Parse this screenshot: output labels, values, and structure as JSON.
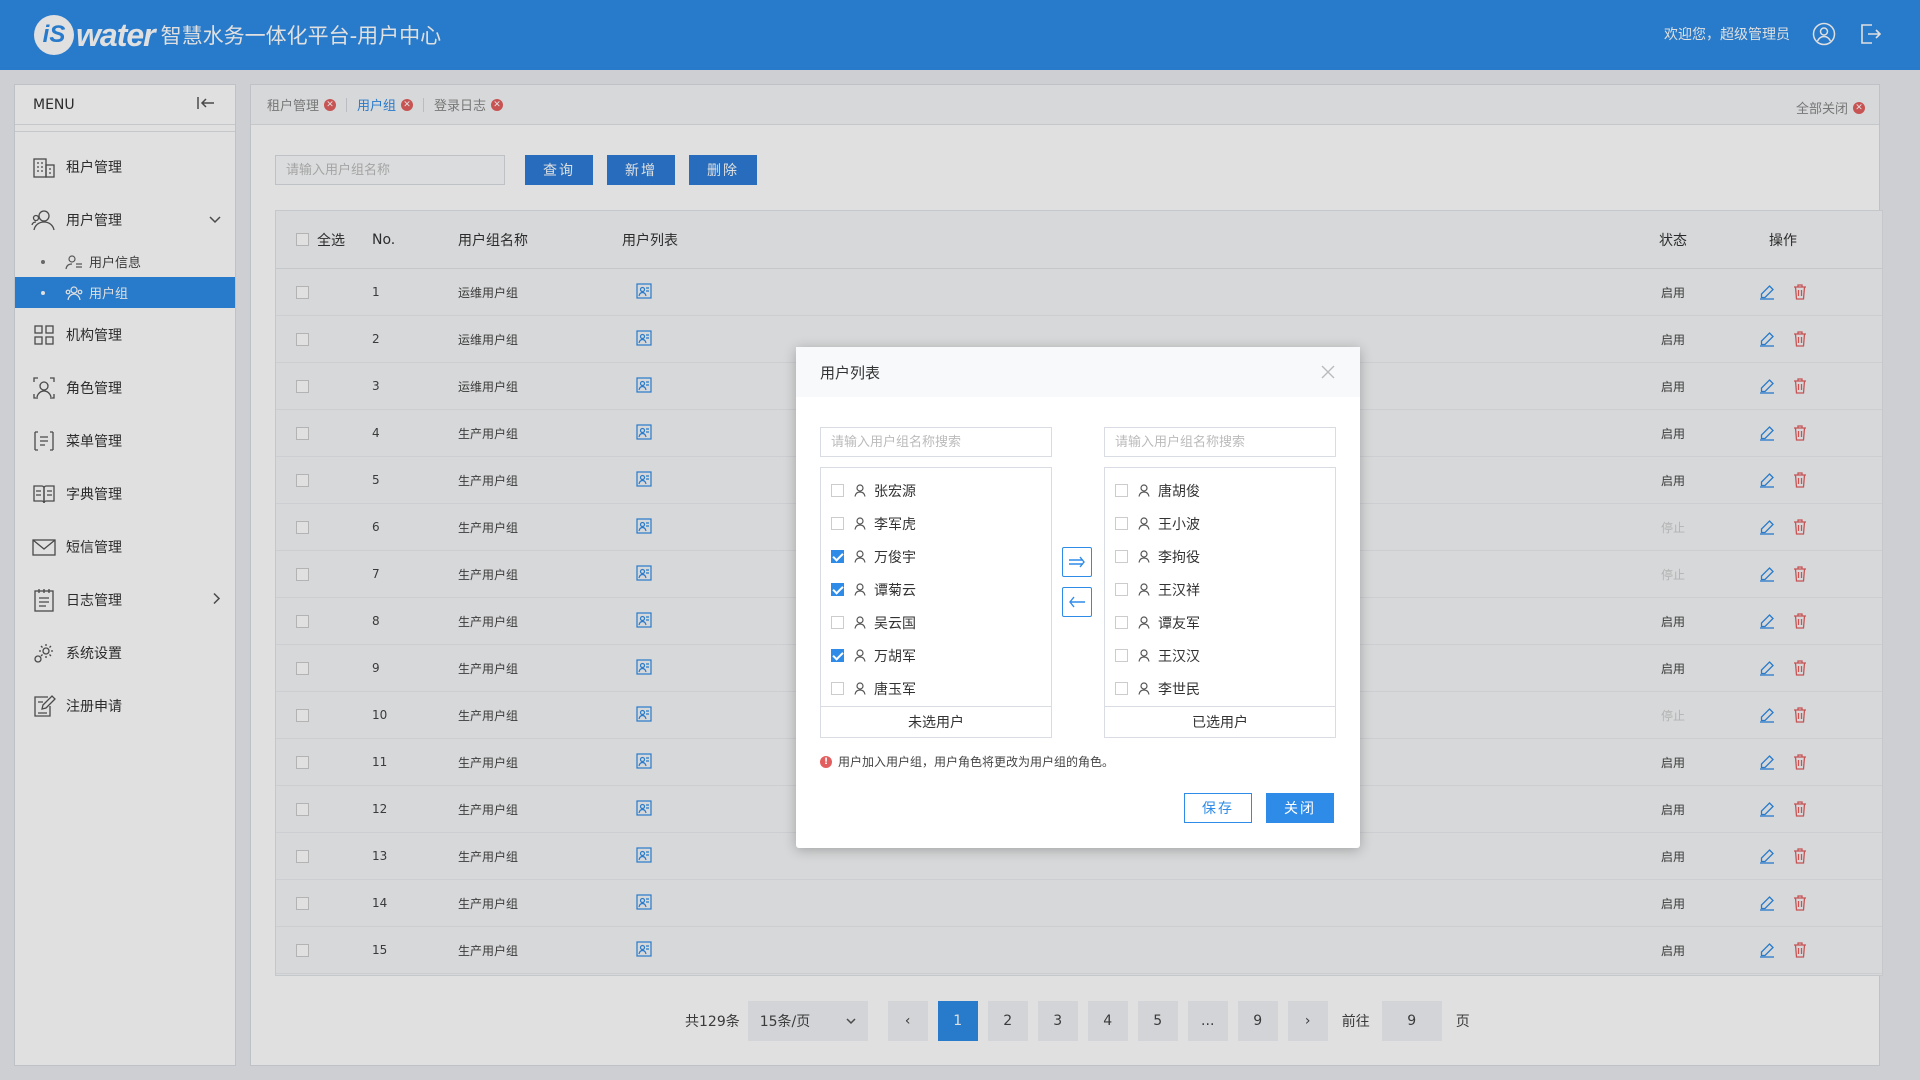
{
  "header": {
    "logo_is": "iS",
    "logo_water": "water",
    "title": "智慧水务一体化平台-用户中心",
    "welcome": "欢迎您，超级管理员"
  },
  "sidebar": {
    "menu_label": "MENU",
    "items": [
      {
        "label": "租户管理"
      },
      {
        "label": "用户管理"
      },
      {
        "label": "机构管理"
      },
      {
        "label": "角色管理"
      },
      {
        "label": "菜单管理"
      },
      {
        "label": "字典管理"
      },
      {
        "label": "短信管理"
      },
      {
        "label": "日志管理"
      },
      {
        "label": "系统设置"
      },
      {
        "label": "注册申请"
      }
    ],
    "sub_items": [
      {
        "label": "用户信息"
      },
      {
        "label": "用户组"
      }
    ]
  },
  "tabs": [
    {
      "label": "租户管理"
    },
    {
      "label": "用户组"
    },
    {
      "label": "登录日志"
    }
  ],
  "close_all": "全部关闭",
  "toolbar": {
    "search_placeholder": "请输入用户组名称",
    "query": "查询",
    "add": "新增",
    "delete": "删除"
  },
  "table": {
    "headers": {
      "select_all": "全选",
      "no": "No.",
      "name": "用户组名称",
      "list": "用户列表",
      "status": "状态",
      "ops": "操作"
    },
    "rows": [
      {
        "no": "1",
        "name": "运维用户组",
        "status": "启用",
        "active": true
      },
      {
        "no": "2",
        "name": "运维用户组",
        "status": "启用",
        "active": true
      },
      {
        "no": "3",
        "name": "运维用户组",
        "status": "启用",
        "active": true
      },
      {
        "no": "4",
        "name": "生产用户组",
        "status": "启用",
        "active": true
      },
      {
        "no": "5",
        "name": "生产用户组",
        "status": "启用",
        "active": true
      },
      {
        "no": "6",
        "name": "生产用户组",
        "status": "停止",
        "active": false
      },
      {
        "no": "7",
        "name": "生产用户组",
        "status": "停止",
        "active": false
      },
      {
        "no": "8",
        "name": "生产用户组",
        "status": "启用",
        "active": true
      },
      {
        "no": "9",
        "name": "生产用户组",
        "status": "启用",
        "active": true
      },
      {
        "no": "10",
        "name": "生产用户组",
        "status": "停止",
        "active": false
      },
      {
        "no": "11",
        "name": "生产用户组",
        "status": "启用",
        "active": true
      },
      {
        "no": "12",
        "name": "生产用户组",
        "status": "启用",
        "active": true
      },
      {
        "no": "13",
        "name": "生产用户组",
        "status": "启用",
        "active": true
      },
      {
        "no": "14",
        "name": "生产用户组",
        "status": "启用",
        "active": true
      },
      {
        "no": "15",
        "name": "生产用户组",
        "status": "启用",
        "active": true
      }
    ]
  },
  "pager": {
    "total": "共129条",
    "page_size": "15条/页",
    "prev": "‹",
    "next": "›",
    "pages": [
      "1",
      "2",
      "3",
      "4",
      "5",
      "...",
      "9"
    ],
    "current": "1",
    "goto_label": "前往",
    "goto_value": "9",
    "page_unit": "页"
  },
  "modal": {
    "title": "用户列表",
    "left_search_placeholder": "请输入用户组名称搜索",
    "right_search_placeholder": "请输入用户组名称搜索",
    "left_users": [
      {
        "name": "张宏源",
        "checked": false
      },
      {
        "name": "李军虎",
        "checked": false
      },
      {
        "name": "万俊宇",
        "checked": true
      },
      {
        "name": "谭菊云",
        "checked": true
      },
      {
        "name": "吴云国",
        "checked": false
      },
      {
        "name": "万胡军",
        "checked": true
      },
      {
        "name": "唐玉军",
        "checked": false
      }
    ],
    "right_users": [
      {
        "name": "唐胡俊",
        "checked": false
      },
      {
        "name": "王小波",
        "checked": false
      },
      {
        "name": "李拘役",
        "checked": false
      },
      {
        "name": "王汉祥",
        "checked": false
      },
      {
        "name": "谭友军",
        "checked": false
      },
      {
        "name": "王汉汉",
        "checked": false
      },
      {
        "name": "李世民",
        "checked": false
      }
    ],
    "left_footer": "未选用户",
    "right_footer": "已选用户",
    "notice": "用户加入用户组，用户角色将更改为用户组的角色。",
    "notice_mark": "!",
    "save": "保存",
    "close": "关闭"
  },
  "colors": {
    "primary": "#2e8be8",
    "danger": "#e35f5f"
  }
}
